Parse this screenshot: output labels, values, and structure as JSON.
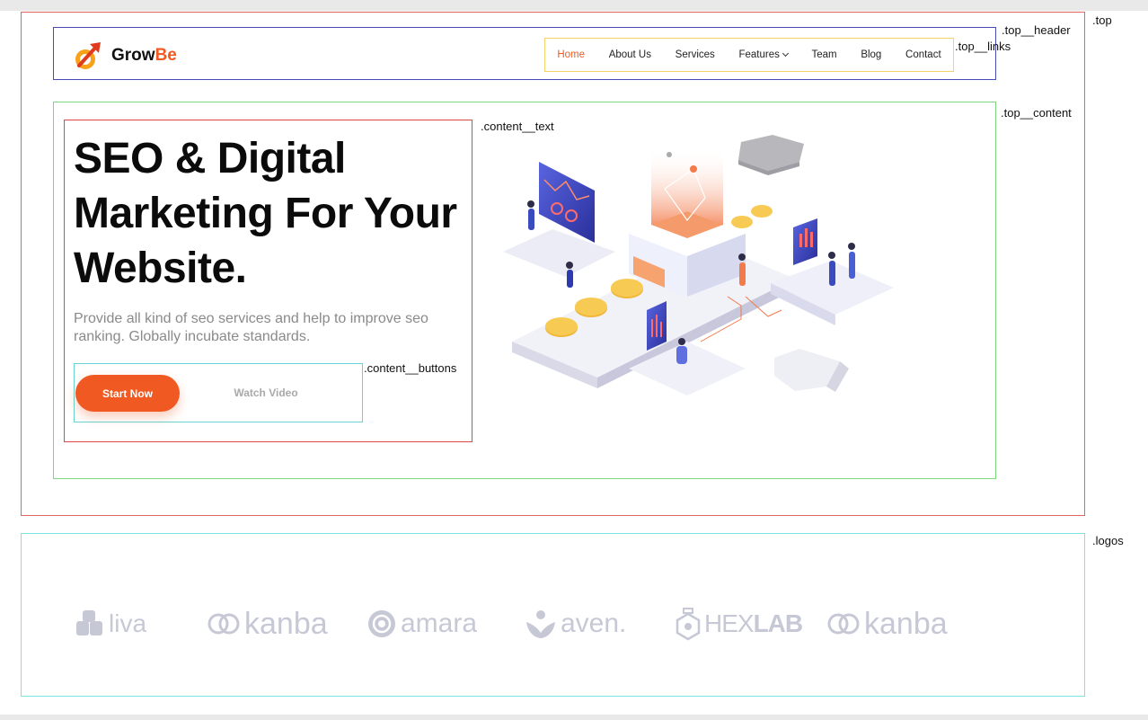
{
  "css_labels": {
    "top": ".top",
    "top_header": ".top__header",
    "top_links": ".top__links",
    "top_content": ".top__content",
    "content_text": ".content__text",
    "content_buttons": ".content__buttons",
    "logos": ".logos"
  },
  "brand": {
    "name_part1": "Grow",
    "name_part2": "Be",
    "accent": "#f05a22"
  },
  "nav": {
    "items": [
      {
        "label": "Home",
        "active": true
      },
      {
        "label": "About Us"
      },
      {
        "label": "Services"
      },
      {
        "label": "Features",
        "has_dropdown": true
      },
      {
        "label": "Team"
      },
      {
        "label": "Blog"
      },
      {
        "label": "Contact"
      }
    ]
  },
  "hero": {
    "headline_line1": "SEO & Digital",
    "headline_line2": "Marketing For Your",
    "headline_line3": "Website.",
    "description": "Provide all kind of seo services and help to improve seo ranking. Globally incubate standards.",
    "primary_button": "Start Now",
    "secondary_button": "Watch Video"
  },
  "logos": [
    {
      "name": "liva",
      "icon": "puzzle-icon"
    },
    {
      "name": "kanba",
      "icon": "link-rings-icon"
    },
    {
      "name": "amara",
      "icon": "at-seal-icon"
    },
    {
      "name": "aven.",
      "icon": "lotus-icon"
    },
    {
      "name_part1": "HEX",
      "name_part2": "LAB",
      "icon": "flask-hexagon-icon"
    },
    {
      "name": "kanba",
      "icon": "link-rings-icon"
    }
  ],
  "colors": {
    "outline_top": "#e06666",
    "outline_header": "#4a4ab8",
    "outline_links": "#f3d36b",
    "outline_content": "#7bd97b",
    "outline_text": "#e04848",
    "outline_buttons": "#66d4d4",
    "outline_logos": "#7de3e3",
    "logo_gray": "#c7c8d6"
  }
}
